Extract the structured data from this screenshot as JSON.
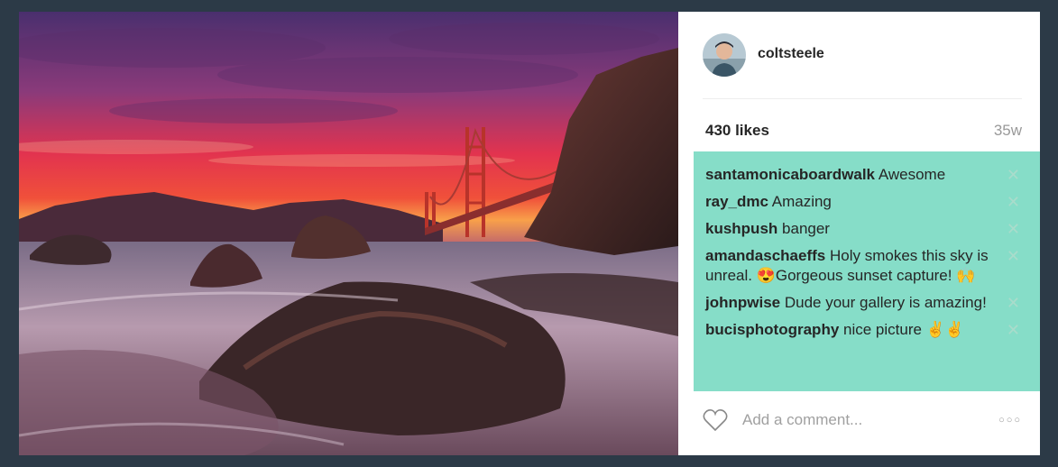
{
  "post": {
    "username": "coltsteele",
    "likes": "430 likes",
    "time": "35w",
    "comments": [
      {
        "user": "santamonicaboardwalk",
        "text": "Awesome"
      },
      {
        "user": "ray_dmc",
        "text": "Amazing"
      },
      {
        "user": "kushpush",
        "text": "banger"
      },
      {
        "user": "amandaschaeffs",
        "text": "Holy smokes this sky is unreal. 😍Gorgeous sunset capture! 🙌"
      },
      {
        "user": "johnpwise",
        "text": "Dude your gallery is amazing!"
      },
      {
        "user": "bucisphotography",
        "text": "nice picture ✌✌"
      }
    ],
    "comment_placeholder": "Add a comment...",
    "more_label": "○○○",
    "delete_label": "✕"
  },
  "colors": {
    "page_background": "#2c3a47",
    "comments_background": "#86ddc8",
    "delete_icon": "#a9dccb"
  },
  "icons": {
    "like": "heart-icon",
    "delete": "close-icon",
    "more": "more-options-icon"
  }
}
